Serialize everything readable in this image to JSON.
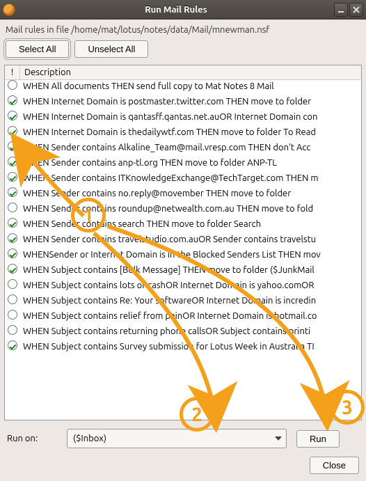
{
  "window": {
    "title": "Run Mail Rules"
  },
  "path_line": "Mail rules in file /home/mat/lotus/notes/data/Mail/mnewman.nsf",
  "buttons": {
    "select_all": "Select All",
    "unselect_all": "Unselect All",
    "run": "Run",
    "close": "Close"
  },
  "columns": {
    "exclaim": "!",
    "description": "Description"
  },
  "run_on": {
    "label": "Run on:",
    "value": "($Inbox)"
  },
  "rules": [
    {
      "checked": false,
      "text": "WHEN   All documents THEN  send full copy to Mat Notes 8 Mail"
    },
    {
      "checked": true,
      "text": "WHEN   Internet Domain is postmaster.twitter.com THEN  move to folder "
    },
    {
      "checked": true,
      "text": "WHEN   Internet Domain is qantasff.qantas.net.auOR Internet Domain con"
    },
    {
      "checked": true,
      "text": "WHEN   Internet Domain is thedailywtf.com THEN  move to folder To Read"
    },
    {
      "checked": true,
      "text": "WHEN   Sender contains Alkaline_Team@mail.vresp.com THEN  don't Acc"
    },
    {
      "checked": true,
      "text": "WHEN   Sender contains anp-tl.org THEN  move to folder ANP-TL"
    },
    {
      "checked": true,
      "text": "WHEN   Sender contains ITKnowledgeExchange@TechTarget.com THEN  m"
    },
    {
      "checked": true,
      "text": "WHEN   Sender contains no.reply@movember THEN  move to folder "
    },
    {
      "checked": false,
      "text": "WHEN   Sender contains roundup@netwealth.com.au THEN  move to fold"
    },
    {
      "checked": true,
      "text": "WHEN   Sender contains search THEN  move to folder Search"
    },
    {
      "checked": true,
      "text": "WHEN   Sender contains travelstudio.com.auOR Sender contains travelstu"
    },
    {
      "checked": true,
      "text": "WHENSender or Internet Domain is in the Blocked Senders List THEN mov"
    },
    {
      "checked": true,
      "text": "WHEN   Subject contains [Bulk Message] THEN  move to folder ($JunkMail"
    },
    {
      "checked": false,
      "text": "WHEN   Subject contains lots of cashOR Internet Domain is yahoo.comOR"
    },
    {
      "checked": false,
      "text": "WHEN   Subject contains Re: Your softwareOR Internet Domain is incredin"
    },
    {
      "checked": false,
      "text": "WHEN   Subject contains relief from painOR Internet Domain is hotmail.co"
    },
    {
      "checked": false,
      "text": "WHEN   Subject  contains returning phone callsOR Subject  contains printi"
    },
    {
      "checked": true,
      "text": "WHEN   Subject contains Survey submission for Lotus Week in Australia TI"
    }
  ],
  "annotations": {
    "n1": "1",
    "n2": "2",
    "n3": "3"
  }
}
